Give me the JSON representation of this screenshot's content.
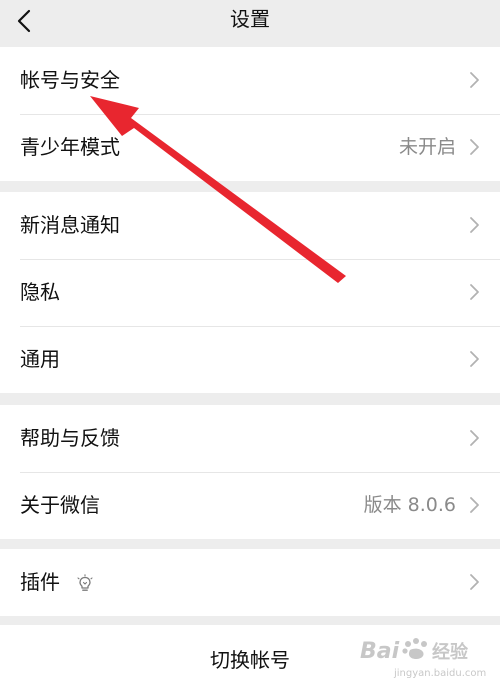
{
  "header": {
    "title": "设置",
    "back_icon": "chevron-left-icon"
  },
  "groups": [
    {
      "items": [
        {
          "label": "帐号与安全",
          "value": ""
        },
        {
          "label": "青少年模式",
          "value": "未开启"
        }
      ]
    },
    {
      "items": [
        {
          "label": "新消息通知",
          "value": ""
        },
        {
          "label": "隐私",
          "value": ""
        },
        {
          "label": "通用",
          "value": ""
        }
      ]
    },
    {
      "items": [
        {
          "label": "帮助与反馈",
          "value": ""
        },
        {
          "label": "关于微信",
          "value": "版本 8.0.6"
        }
      ]
    },
    {
      "items": [
        {
          "label": "插件",
          "value": "",
          "icon": "lightbulb-icon"
        }
      ]
    }
  ],
  "footer": {
    "switch_account_label": "切换帐号"
  },
  "overlay": {
    "annotation": "red-arrow-pointing-to-account-security",
    "watermark": "Baidu 经验 jingyan.baidu.com"
  },
  "colors": {
    "background": "#ededed",
    "card": "#ffffff",
    "secondary_text": "#8a8a8a",
    "annotation_red": "#e8262f"
  }
}
